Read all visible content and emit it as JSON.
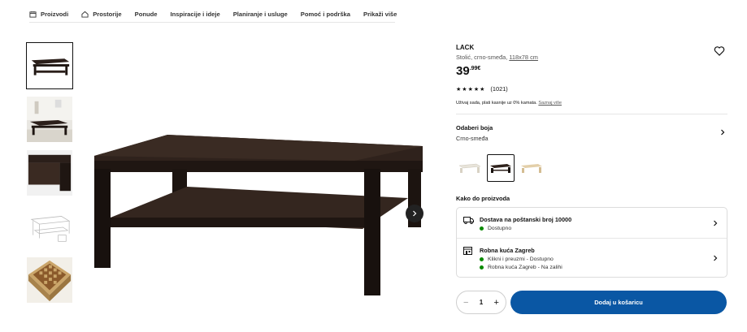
{
  "nav": {
    "items": [
      {
        "label": "Proizvodi",
        "icon": "calendar-box-icon"
      },
      {
        "label": "Prostorije",
        "icon": "home-icon"
      },
      {
        "label": "Ponude"
      },
      {
        "label": "Inspiracije i ideje"
      },
      {
        "label": "Planiranje i usluge"
      },
      {
        "label": "Pomoć i podrška"
      },
      {
        "label": "Prikaži više"
      }
    ]
  },
  "gallery": {
    "thumbnails": [
      "table-front-view",
      "table-in-room",
      "table-corner-detail",
      "table-line-drawing",
      "table-top-pattern"
    ],
    "active_index": 0,
    "next_icon": "chevron-right-icon"
  },
  "product": {
    "name": "LACK",
    "description": "Stolić, crno-smeđa,",
    "dimensions": "118x78 cm",
    "price_int": "39",
    "price_dec": ".99€",
    "rating_value": 4.5,
    "reviews": "(1021)",
    "credit_text": "Uživaj sada, plati kasnije uz 0% kamata.",
    "credit_link": "Saznaj više"
  },
  "color": {
    "title": "Odaberi boja",
    "value": "Crno-smeđa",
    "swatches": [
      "white",
      "black-brown",
      "oak-effect"
    ],
    "selected_index": 1
  },
  "delivery": {
    "title": "Kako do proizvoda",
    "shipping": {
      "title": "Dostava na poštanski broj 10000",
      "status": "Dostupno"
    },
    "store": {
      "title": "Robna kuća Zagreb",
      "line1": "Klikni i preuzmi - Dostupno",
      "line2": "Robna kuća Zagreb - Na zalihi"
    }
  },
  "purchase": {
    "quantity": "1",
    "minus": "−",
    "plus": "+",
    "add_label": "Dodaj u košaricu"
  },
  "colors": {
    "accent": "#0a57a4",
    "status_green": "#0a8a00",
    "wood": "#2b1f1a"
  }
}
